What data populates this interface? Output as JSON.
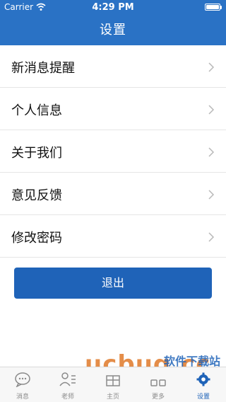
{
  "status_bar": {
    "carrier": "Carrier",
    "time": "4:29 PM"
  },
  "nav": {
    "title": "设置"
  },
  "settings": {
    "items": [
      {
        "label": "新消息提醒"
      },
      {
        "label": "个人信息"
      },
      {
        "label": "关于我们"
      },
      {
        "label": "意见反馈"
      },
      {
        "label": "修改密码"
      }
    ],
    "logout_label": "退出"
  },
  "watermark": {
    "text": "ucbug.cc",
    "sub": "软件下载站"
  },
  "tabbar": {
    "tabs": [
      {
        "label": "消息",
        "icon": "chat-icon"
      },
      {
        "label": "老师",
        "icon": "teacher-icon"
      },
      {
        "label": "主页",
        "icon": "home-icon"
      },
      {
        "label": "更多",
        "icon": "more-icon"
      },
      {
        "label": "设置",
        "icon": "settings-gear-icon"
      }
    ],
    "active_index": 4
  },
  "colors": {
    "header_bg": "#2a72c5",
    "button_bg": "#1f63b8",
    "active_tab": "#1f63b8"
  }
}
